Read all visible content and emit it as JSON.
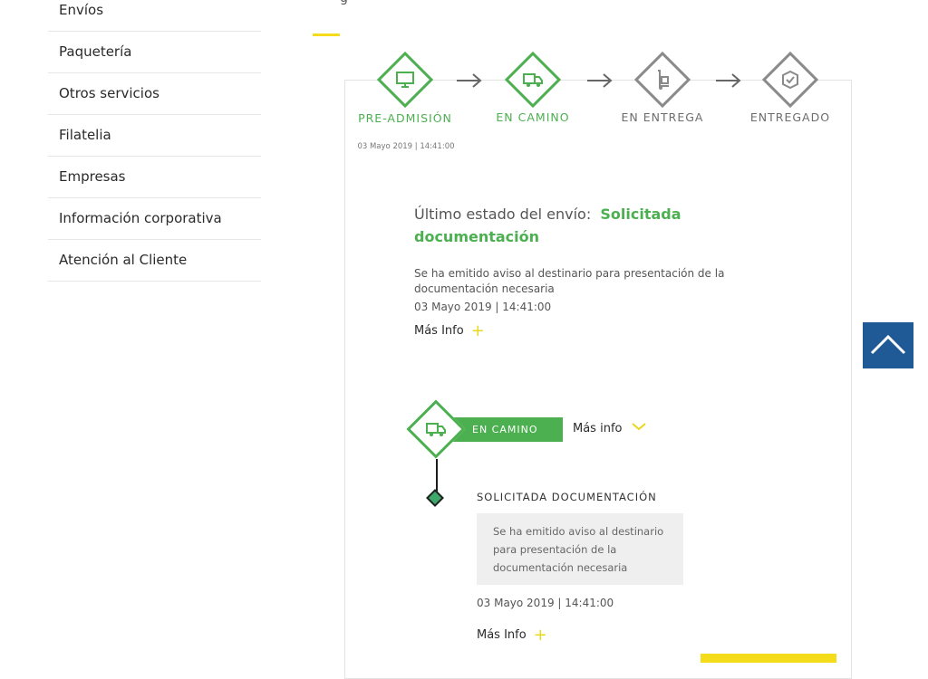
{
  "sidebar": {
    "items": [
      {
        "label": "Envíos"
      },
      {
        "label": "Paquetería"
      },
      {
        "label": "Otros servicios"
      },
      {
        "label": "Filatelia"
      },
      {
        "label": "Empresas"
      },
      {
        "label": "Información corporativa"
      },
      {
        "label": "Atención al Cliente"
      }
    ]
  },
  "header": {
    "partial_text": "g"
  },
  "steps": [
    {
      "label": "PRE-ADMISIÓN",
      "date": "03 Mayo 2019 | 14:41:00",
      "state": "done",
      "icon": "computer-icon"
    },
    {
      "label": "EN CAMINO",
      "state": "done",
      "icon": "truck-icon"
    },
    {
      "label": "EN ENTREGA",
      "state": "pending",
      "icon": "hand-truck-icon"
    },
    {
      "label": "ENTREGADO",
      "state": "pending",
      "icon": "box-check-icon"
    }
  ],
  "status": {
    "prefix": "Último estado del envío:",
    "value": "Solicitada documentación",
    "description": "Se ha emitido aviso al destinario para presentación de la documentación necesaria",
    "date": "03 Mayo 2019 | 14:41:00",
    "more_label": "Más Info"
  },
  "timeline": {
    "stage_label": "EN CAMINO",
    "dropdown_label": "Más info",
    "event_title": "SOLICITADA DOCUMENTACIÓN",
    "event_description": "Se ha emitido aviso al destinario para presentación de la documentación necesaria",
    "event_date": "03 Mayo 2019 | 14:41:00",
    "event_more_label": "Más Info"
  },
  "colors": {
    "green": "#4caf50",
    "yellow": "#f4dc1b",
    "blue": "#1f5a96",
    "gray": "#8a8a8a"
  }
}
